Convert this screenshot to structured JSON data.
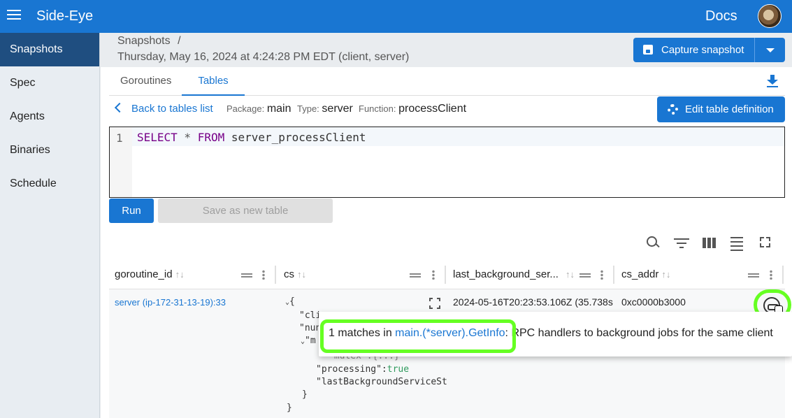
{
  "appbar": {
    "title": "Side-Eye",
    "docs": "Docs"
  },
  "sidebar": {
    "items": [
      {
        "label": "Snapshots",
        "active": true
      },
      {
        "label": "Spec"
      },
      {
        "label": "Agents"
      },
      {
        "label": "Binaries"
      },
      {
        "label": "Schedule"
      }
    ]
  },
  "breadcrumb": {
    "root": "Snapshots",
    "sep": "/"
  },
  "snapshot": {
    "title": "Thursday, May 16, 2024 at 4:24:28 PM EDT (client, server)"
  },
  "capture": {
    "label": "Capture snapshot"
  },
  "tabs": [
    {
      "label": "Goroutines"
    },
    {
      "label": "Tables"
    }
  ],
  "table_view": {
    "back_label": "Back to tables list",
    "package_label": "Package:",
    "package": "main",
    "type_label": "Type:",
    "type": "server",
    "function_label": "Function:",
    "function": "processClient",
    "edit_label": "Edit table definition"
  },
  "editor": {
    "line_no": "1",
    "kw_select": "SELECT",
    "star": " * ",
    "kw_from": "FROM",
    "table": " server_processClient"
  },
  "actions": {
    "run": "Run",
    "save_as": "Save as new table"
  },
  "columns": [
    {
      "label": "goroutine_id"
    },
    {
      "label": "cs"
    },
    {
      "label": "last_background_ser..."
    },
    {
      "label": "cs_addr"
    }
  ],
  "sort_icon": "↑↓",
  "row": {
    "goroutine_id": "server (ip-172-31-13-19):33",
    "json_open": "{",
    "json_k1": "\"cli",
    "json_k2": "\"nun",
    "json_k3": "\"m",
    "json_mutex": "\"mutex\":{...}",
    "json_processing_key": "\"processing\"",
    "json_colon": ":",
    "json_processing_val": "true",
    "json_lbs": "\"lastBackgroundServiceSt",
    "json_inner_close": "}",
    "json_close": "}",
    "last_background": "2024-05-16T20:23:53.106Z (35.738s",
    "cs_addr": "0xc0000b3000"
  },
  "popover": {
    "prefix": "1 matches in ",
    "link": "main.(*server).GetInfo",
    "suffix": ": RPC handlers to background jobs for the same client"
  },
  "colors": {
    "primary": "#1976d2",
    "highlight": "#66ff22",
    "sidebar_active": "#1f4e80"
  }
}
